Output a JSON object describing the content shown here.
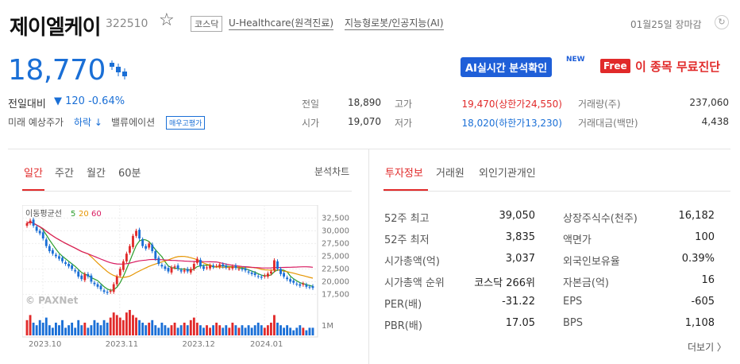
{
  "header": {
    "name": "제이엘케이",
    "code": "322510",
    "market": "코스닥",
    "sector": "U-Healthcare(원격진료)",
    "theme": "지능형로봇/인공지능(AI)",
    "date": "01월25일 장마감"
  },
  "price": {
    "current": "18,770",
    "change_label": "전일대비",
    "change_value": "▼ 120 -0.64%",
    "pred_label": "미래 예상주가",
    "pred_value": "하락 ↓",
    "valuation_label": "밸류에이션",
    "valuation_badge": "매우고평가"
  },
  "buttons": {
    "ai_label": "AI실시간 분석확인",
    "ai_new": "NEW",
    "free_badge": "Free",
    "free_text": "이 종목 무료진단"
  },
  "stats": [
    {
      "label": "전일",
      "value": "18,890"
    },
    {
      "label": "시가",
      "value": "19,070"
    },
    {
      "label": "고가",
      "value": "19,470(상한가24,550)",
      "color": "#e12a2a"
    },
    {
      "label": "저가",
      "value": "18,020(하한가13,230)",
      "color": "#1a6fd6"
    },
    {
      "label": "거래량(주)",
      "value": "237,060"
    },
    {
      "label": "거래대금(백만)",
      "value": "4,438"
    }
  ],
  "chart_tabs": [
    "일간",
    "주간",
    "월간",
    "60분"
  ],
  "analysis_link": "분석차트",
  "info_tabs": [
    "투자정보",
    "거래원",
    "외인기관개인"
  ],
  "chart_data": {
    "type": "candlestick",
    "legend_label": "이동평균선",
    "ma_labels": [
      "5",
      "20",
      "60"
    ],
    "ma_colors": [
      "#2a9d2a",
      "#e69500",
      "#d81b60"
    ],
    "yticks": [
      "32,500",
      "30,000",
      "27,500",
      "25,000",
      "22,500",
      "20,000",
      "17,500"
    ],
    "volume_tick": "1M",
    "xticks": [
      "2023.10",
      "2023.11",
      "2023.12",
      "2024.01"
    ],
    "watermark": "© PAXNet",
    "ylim": [
      16000,
      33500
    ],
    "closes": [
      31500,
      32000,
      31000,
      30000,
      29500,
      28500,
      27000,
      26000,
      25500,
      25000,
      24500,
      24000,
      23500,
      23000,
      22500,
      22000,
      21000,
      20500,
      21500,
      21000,
      20000,
      19500,
      19000,
      18500,
      18000,
      17800,
      18200,
      19500,
      21000,
      22500,
      24000,
      25500,
      27000,
      29000,
      30000,
      28500,
      27000,
      26500,
      27500,
      26000,
      24500,
      23500,
      23000,
      22500,
      22000,
      22800,
      23000,
      22500,
      22000,
      22300,
      22000,
      22500,
      23500,
      24500,
      23000,
      22500,
      22800,
      23200,
      22900,
      23100,
      23400,
      23000,
      22800,
      22600,
      23000,
      22700,
      22500,
      22400,
      22200,
      21800,
      21500,
      21300,
      21000,
      20800,
      21200,
      21600,
      22000,
      24200,
      22500,
      21500,
      21000,
      20500,
      20000,
      19800,
      19500,
      19200,
      19600,
      19000,
      18900,
      18770
    ],
    "volumes": [
      0.6,
      0.8,
      0.5,
      0.4,
      0.6,
      0.5,
      0.7,
      0.4,
      0.3,
      0.5,
      0.4,
      0.6,
      0.3,
      0.4,
      0.5,
      0.3,
      0.6,
      0.4,
      0.5,
      0.3,
      0.4,
      0.6,
      0.5,
      0.4,
      0.6,
      0.5,
      0.7,
      0.9,
      0.8,
      0.7,
      0.6,
      0.9,
      1.0,
      0.8,
      0.7,
      0.6,
      0.5,
      0.4,
      0.5,
      0.6,
      0.4,
      0.3,
      0.5,
      0.4,
      0.3,
      0.4,
      0.5,
      0.3,
      0.4,
      0.5,
      0.4,
      0.6,
      0.7,
      0.5,
      0.4,
      0.3,
      0.4,
      0.3,
      0.4,
      0.5,
      0.4,
      0.3,
      0.4,
      0.3,
      0.5,
      0.4,
      0.3,
      0.4,
      0.3,
      0.4,
      0.3,
      0.4,
      0.5,
      0.4,
      0.3,
      0.4,
      0.5,
      0.8,
      0.5,
      0.4,
      0.3,
      0.4,
      0.3,
      0.2,
      0.3,
      0.4,
      0.3,
      0.2,
      0.3,
      0.3
    ]
  },
  "info": [
    {
      "label": "52주 최고",
      "value": "39,050"
    },
    {
      "label": "52주 최저",
      "value": "3,835"
    },
    {
      "label": "시가총액(억)",
      "value": "3,037"
    },
    {
      "label": "시가총액 순위",
      "value": "코스닥 266위"
    },
    {
      "label": "PER(배)",
      "value": "-31.22"
    },
    {
      "label": "PBR(배)",
      "value": "17.05"
    },
    {
      "label": "상장주식수(천주)",
      "value": "16,182"
    },
    {
      "label": "액면가",
      "value": "100"
    },
    {
      "label": "외국인보유율",
      "value": "0.39%"
    },
    {
      "label": "자본금(억)",
      "value": "16"
    },
    {
      "label": "EPS",
      "value": "-605"
    },
    {
      "label": "BPS",
      "value": "1,108"
    }
  ],
  "more_link": "더보기 〉"
}
